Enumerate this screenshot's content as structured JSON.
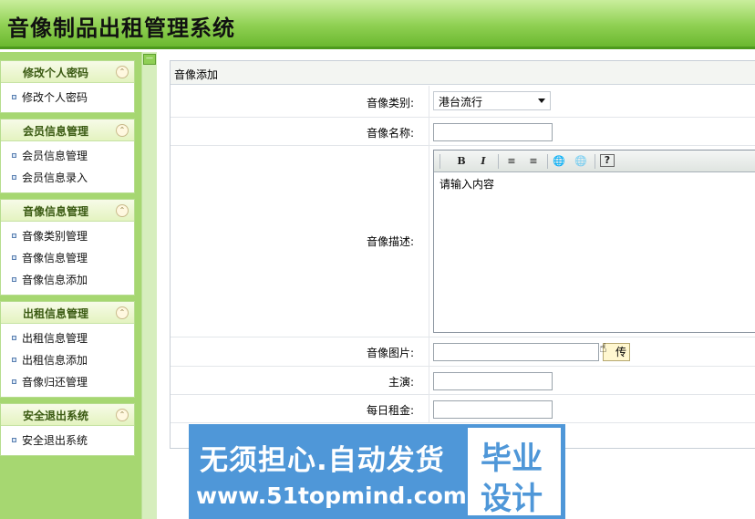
{
  "app": {
    "title": "音像制品出租管理系统"
  },
  "sidebar": {
    "groups": [
      {
        "title": "修改个人密码",
        "items": [
          "修改个人密码"
        ]
      },
      {
        "title": "会员信息管理",
        "items": [
          "会员信息管理",
          "会员信息录入"
        ]
      },
      {
        "title": "音像信息管理",
        "items": [
          "音像类别管理",
          "音像信息管理",
          "音像信息添加"
        ]
      },
      {
        "title": "出租信息管理",
        "items": [
          "出租信息管理",
          "出租信息添加",
          "音像归还管理"
        ]
      },
      {
        "title": "安全退出系统",
        "items": [
          "安全退出系统"
        ]
      }
    ],
    "collapse_glyph": "⌃"
  },
  "main": {
    "section_title": "音像添加",
    "fields": {
      "category": {
        "label": "音像类别:",
        "value": "港台流行"
      },
      "name": {
        "label": "音像名称:",
        "value": ""
      },
      "description": {
        "label": "音像描述:",
        "value": "请输入内容"
      },
      "image": {
        "label": "音像图片:",
        "value": "",
        "button": "传"
      },
      "lead_actor": {
        "label": "主演:",
        "value": ""
      },
      "daily_rent": {
        "label": "每日租金:",
        "value": ""
      }
    },
    "editor_toolbar": {
      "bold": "B",
      "italic": "I",
      "ordered_list": "≡",
      "unordered_list": "≡",
      "link": "🌐",
      "unlink": "🌐",
      "help": "?"
    }
  },
  "watermark": {
    "line1": "无须担心.自动发货",
    "line2": "www.51topmind.com",
    "box1": "毕业",
    "box2": "设计"
  }
}
